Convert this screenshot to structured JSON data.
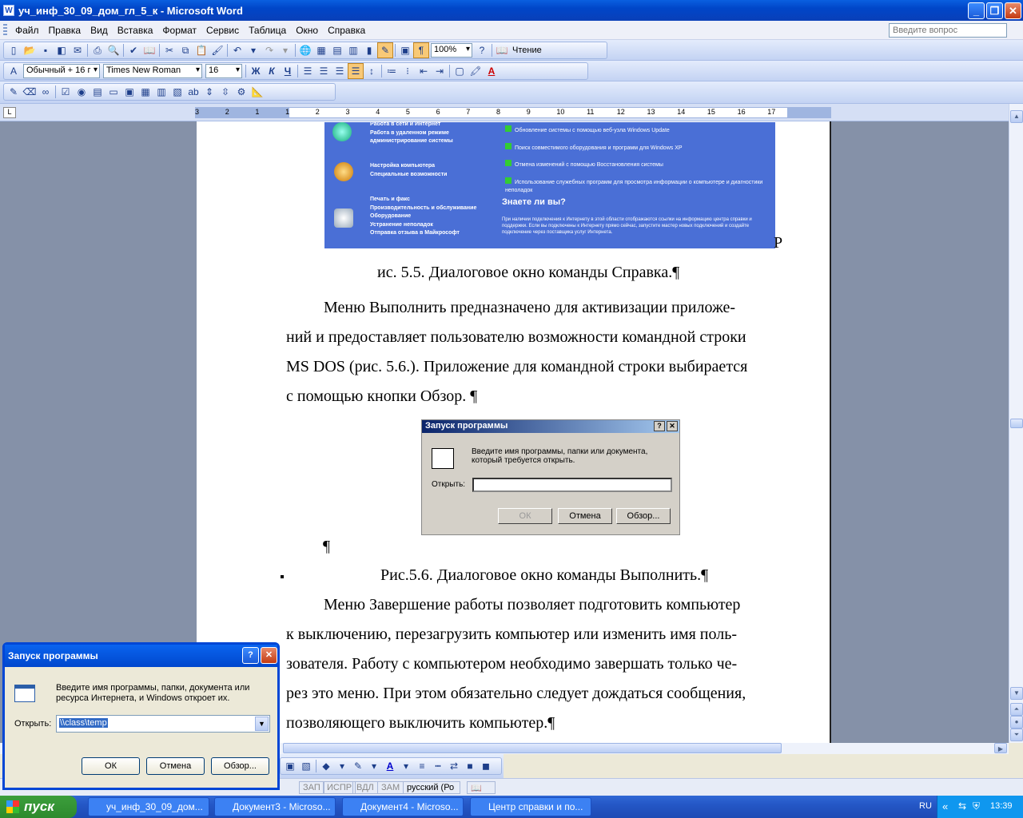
{
  "window": {
    "title": "уч_инф_30_09_дом_гл_5_к - Microsoft Word",
    "app_icon": "W"
  },
  "menu": {
    "items": [
      "Файл",
      "Правка",
      "Вид",
      "Вставка",
      "Формат",
      "Сервис",
      "Таблица",
      "Окно",
      "Справка"
    ],
    "ask_placeholder": "Введите вопрос"
  },
  "toolbar": {
    "zoom": "100%",
    "reading_label": "Чтение",
    "style": "Обычный + 16 г",
    "font": "Times New Roman",
    "size": "16"
  },
  "ruler": {
    "ticks": [
      "3",
      "2",
      "1",
      "1",
      "2",
      "3",
      "4",
      "5",
      "6",
      "7",
      "8",
      "9",
      "10",
      "11",
      "12",
      "13",
      "14",
      "15",
      "16",
      "17"
    ]
  },
  "help_image": {
    "left_items": [
      "Работа в сети и Интернет",
      "Работа в удаленном режиме",
      "администрирование системы",
      "Настройка компьютера",
      "Специальные возможности",
      "Печать и факс",
      "Производительность и обслуживание",
      "Оборудование",
      "Устранение неполадок",
      "Отправка отзыва в Майкрософт"
    ],
    "right_items": [
      "Обновление системы с помощью веб-узла Windows Update",
      "Поиск совместимого оборудования и программ для Windows XP",
      "Отмена изменений с помощью Восстановления системы",
      "Использование служебных программ для просмотра информации о компьютере и диагностики неполадок"
    ],
    "did_you_know": "Знаете ли вы?",
    "tip": "При наличии подключения к Интернету в этой области отображаются ссылки на информацию центра справки и поддержки. Если вы подключены к Интернету прямо сейчас, запустите мастер новых подключений и создайте подключение через поставщика услуг Интернета."
  },
  "doc": {
    "stray_r": "Р",
    "caption1": "ис. 5.5. Диалоговое окно команды Справка.¶",
    "p1_l1": "Меню Выполнить предназначено для активизации приложе-",
    "p1_l2": "ний и предоставляет пользователю возможности командной строки",
    "p1_l3": "MS DOS (рис. 5.6.). Приложение для командной строки выбирается",
    "p1_l4": "с помощью кнопки Обзор. ¶",
    "pilcrow": "¶",
    "caption2": "Рис.5.6. Диалоговое окно команды Выполнить.¶",
    "p2_l1": "Меню Завершение работы позволяет подготовить компьютер",
    "p2_l2": "к выключению, перезагрузить компьютер или изменить имя поль-",
    "p2_l3": "зователя. Работу с компьютером необходимо завершать только че-",
    "p2_l4": "рез это меню. При этом обязательно следует дождаться сообщения,",
    "p2_l5": "позволяющего выключить компьютер.¶"
  },
  "doc_dialog": {
    "title": "Запуск программы",
    "prompt1": "Введите имя программы, папки или документа,",
    "prompt2": "который требуется открыть.",
    "open_label": "Открыть:",
    "ok": "ОК",
    "cancel": "Отмена",
    "browse": "Обзор..."
  },
  "run_dialog": {
    "title": "Запуск программы",
    "prompt1": "Введите имя программы, папки, документа или",
    "prompt2": "ресурса Интернета, и Windows откроет их.",
    "open_label": "Открыть:",
    "open_value": "\\\\class\\temp",
    "ok": "ОК",
    "cancel": "Отмена",
    "browse": "Обзор..."
  },
  "status": {
    "zap": "ЗАП",
    "ispr": "ИСПР",
    "vdl": "ВДЛ",
    "zam": "ЗАМ",
    "lang": "русский (Ро"
  },
  "taskbar": {
    "start": "пуск",
    "tasks": [
      "уч_инф_30_09_дом...",
      "Документ3 - Microso...",
      "Документ4 - Microso...",
      "Центр справки и по..."
    ],
    "lang": "RU",
    "time": "13:39"
  }
}
